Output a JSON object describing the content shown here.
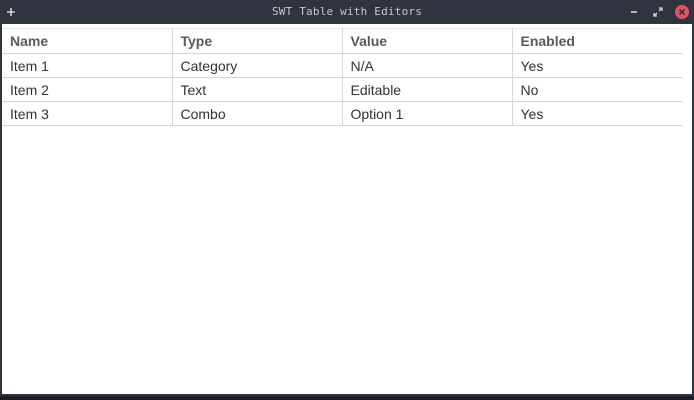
{
  "window": {
    "title": "SWT Table with Editors"
  },
  "table": {
    "columns": [
      "Name",
      "Type",
      "Value",
      "Enabled"
    ],
    "rows": [
      [
        "Item 1",
        "Category",
        "N/A",
        "Yes"
      ],
      [
        "Item 2",
        "Text",
        "Editable",
        "No"
      ],
      [
        "Item 3",
        "Combo",
        "Option 1",
        "Yes"
      ]
    ]
  },
  "icons": {
    "menu": "plus-icon",
    "minimize": "minimize-icon",
    "maximize": "maximize-icon",
    "close": "close-icon"
  },
  "colors": {
    "titlebar": "#2f343f",
    "close": "#e0535f",
    "table_bg": "#ffffff",
    "grid_line": "#d5d5d5"
  }
}
